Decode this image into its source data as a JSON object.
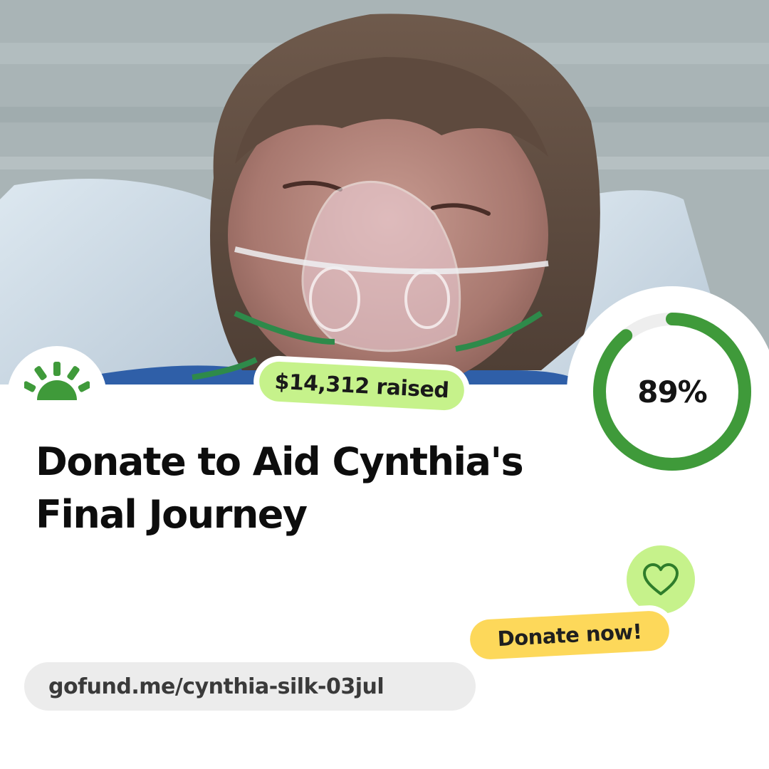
{
  "campaign": {
    "raised_label": "$14,312 raised",
    "progress_percent": 89,
    "progress_label": "89%",
    "title_line1": "Donate to Aid Cynthia's",
    "title_line2": "Final Journey",
    "donate_label": "Donate now!",
    "url": "gofund.me/cynthia-silk-03jul"
  },
  "icons": {
    "logo": "sunrise-logo-icon",
    "heart": "heart-icon"
  },
  "colors": {
    "brand_green": "#3f9a3a",
    "ring_track": "#eeeeee",
    "raised_pill": "#c6f28b",
    "heart_badge": "#c6f28b",
    "donate_pill": "#fdd85a",
    "url_pill": "#ececec",
    "title_text": "#0d0d0d"
  }
}
